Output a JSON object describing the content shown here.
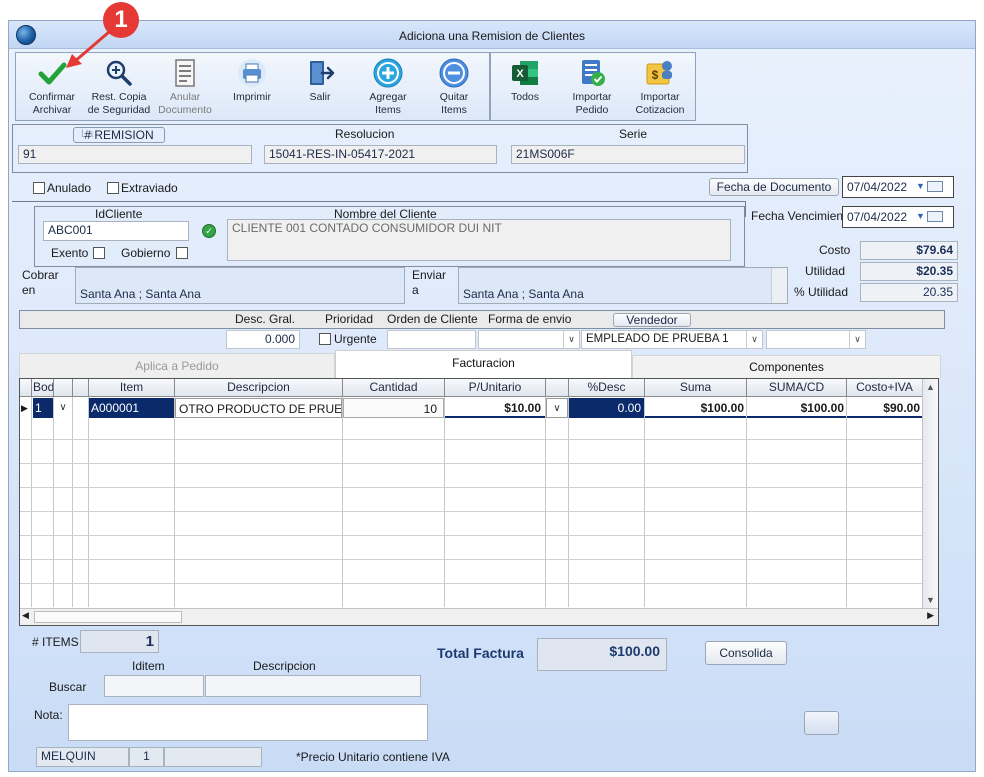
{
  "annotation": {
    "badge": "1"
  },
  "window": {
    "title": "Adiciona una Remision de Clientes"
  },
  "toolbar": {
    "items": [
      {
        "label1": "Confirmar",
        "label2": "Archivar",
        "icon": "check-icon",
        "enabled": true
      },
      {
        "label1": "Rest. Copia",
        "label2": "de Seguridad",
        "icon": "zoom-in-icon",
        "enabled": true
      },
      {
        "label1": "Anular",
        "label2": "Documento",
        "icon": "document-icon",
        "enabled": false
      },
      {
        "label1": "Imprimir",
        "label2": "",
        "icon": "printer-icon",
        "enabled": true
      },
      {
        "label1": "Salir",
        "label2": "",
        "icon": "exit-door-icon",
        "enabled": true
      },
      {
        "label1": "Agregar",
        "label2": "Items",
        "icon": "plus-circle-icon",
        "enabled": true
      },
      {
        "label1": "Quitar",
        "label2": "Items",
        "icon": "minus-circle-icon",
        "enabled": true
      },
      {
        "label1": "Todos",
        "label2": "",
        "icon": "excel-icon",
        "enabled": true
      },
      {
        "label1": "Importar",
        "label2": "Pedido",
        "icon": "import-order-icon",
        "enabled": true
      },
      {
        "label1": "Importar",
        "label2": "Cotizacion",
        "icon": "import-quote-icon",
        "enabled": true
      }
    ]
  },
  "header": {
    "remision_button": "# REMISION",
    "remision_ghost": "La",
    "remision_value": "91",
    "resolucion_label": "Resolucion",
    "resolucion_value": "15041-RES-IN-05417-2021",
    "serie_label": "Serie",
    "serie_value": "21MS006F"
  },
  "status": {
    "anulado": "Anulado",
    "extraviado": "Extraviado"
  },
  "dates": {
    "fecha_documento_button": "Fecha de  Documento",
    "fecha_documento_value": "07/04/2022",
    "fecha_vencimiento_label": "Fecha Vencimien",
    "fecha_vencimiento_value": "07/04/2022"
  },
  "client": {
    "id_label": "IdCliente",
    "id_value": "ABC001",
    "name_label": "Nombre del Cliente",
    "name_value": "CLIENTE 001 CONTADO CONSUMIDOR DUI NIT",
    "exento": "Exento",
    "gobierno": "Gobierno",
    "cobrar_label_1": "Cobrar",
    "cobrar_label_2": "en",
    "cobrar_value": "Santa Ana ; Santa Ana",
    "enviar_label_1": "Enviar",
    "enviar_label_2": "a",
    "enviar_value": "Santa Ana ; Santa Ana"
  },
  "totals_side": {
    "costo_label": "Costo",
    "costo_value": "$79.64",
    "utilidad_label": "Utilidad",
    "utilidad_value": "$20.35",
    "pct_utilidad_label": "% Utilidad",
    "pct_utilidad_value": "20.35"
  },
  "options": {
    "desc_gral_label": "Desc. Gral.",
    "desc_gral_value": "0.000",
    "prioridad_label": "Prioridad",
    "urgente": "Urgente",
    "orden_label": "Orden de Cliente",
    "forma_envio_label": "Forma de envio",
    "vendedor_button": "Vendedor",
    "vendedor_value": "EMPLEADO DE PRUEBA 1"
  },
  "tabs": [
    {
      "label": "Aplica a Pedido",
      "state": "disabled"
    },
    {
      "label": "Facturacion",
      "state": "active"
    },
    {
      "label": "Componentes",
      "state": "normal"
    }
  ],
  "grid": {
    "columns": [
      "Bodeg",
      "",
      "Item",
      "Descripcion",
      "Cantidad",
      "P/Unitario",
      "%Desc",
      "Suma",
      "SUMA/CD",
      "Costo+IVA"
    ],
    "row": {
      "bodega": "1",
      "item": "A000001",
      "descripcion": "OTRO PRODUCTO DE PRUE",
      "cantidad": "10",
      "precio": "$10.00",
      "desc": "0.00",
      "suma": "$100.00",
      "suma_cd": "$100.00",
      "costo_iva": "$90.00"
    }
  },
  "footer": {
    "items_label": "# ITEMS",
    "items_value": "1",
    "total_label": "Total Factura",
    "total_value": "$100.00",
    "consolida_button": "Consolida",
    "iditem_label": "Iditem",
    "descripcion_label": "Descripcion",
    "buscar_label": "Buscar",
    "nota_label": "Nota:",
    "user_value": "MELQUIN",
    "user_num": "1",
    "note_text": "*Precio Unitario contiene IVA"
  },
  "colors": {
    "selection": "#0a2a6b",
    "accent": "#1d5fa6",
    "badge": "#e53935"
  }
}
